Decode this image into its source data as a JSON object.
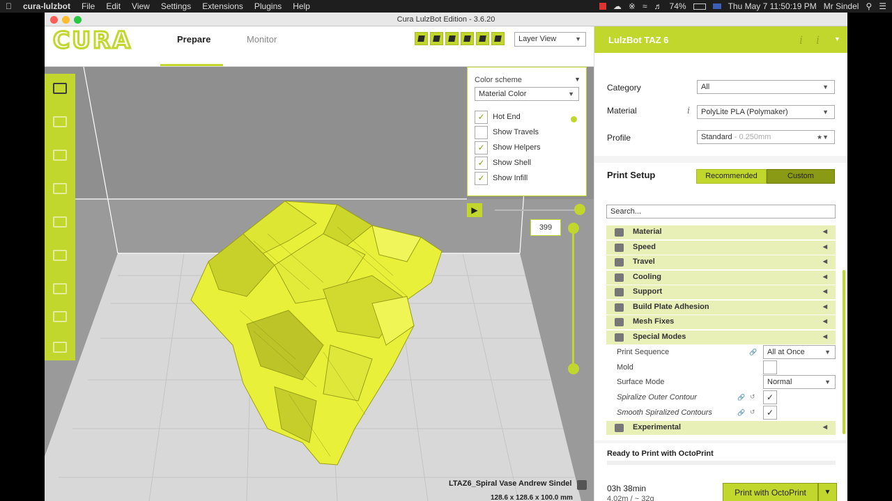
{
  "menubar": {
    "app": "cura-lulzbot",
    "items": [
      "File",
      "Edit",
      "View",
      "Settings",
      "Extensions",
      "Plugins",
      "Help"
    ],
    "battery": "74%",
    "datetime": "Thu May 7  11:50:19 PM",
    "user": "Mr Sindel"
  },
  "window": {
    "title": "Cura LulzBot Edition - 3.6.20"
  },
  "header": {
    "logo": "CURA",
    "tabs": [
      "Prepare",
      "Monitor"
    ],
    "view_mode": "Layer View"
  },
  "color_panel": {
    "label": "Color scheme",
    "scheme": "Material Color",
    "options": [
      {
        "label": "Hot End",
        "checked": true
      },
      {
        "label": "Show Travels",
        "checked": false
      },
      {
        "label": "Show Helpers",
        "checked": true
      },
      {
        "label": "Show Shell",
        "checked": true
      },
      {
        "label": "Show Infill",
        "checked": true
      }
    ]
  },
  "layer_slider": {
    "current_layer": "399"
  },
  "object": {
    "name": "LTAZ6_Spiral Vase Andrew Sindel",
    "dimensions": "128.6 x 128.6 x 100.0 mm"
  },
  "right_panel": {
    "machine": "LulzBot TAZ 6",
    "category_label": "Category",
    "category_value": "All",
    "material_label": "Material",
    "material_value": "PolyLite PLA (Polymaker)",
    "profile_label": "Profile",
    "profile_value": "Standard",
    "profile_dim": "- 0.250mm",
    "print_setup": "Print Setup",
    "recommended": "Recommended",
    "custom": "Custom",
    "search_placeholder": "Search...",
    "categories": [
      "Material",
      "Speed",
      "Travel",
      "Cooling",
      "Support",
      "Build Plate Adhesion",
      "Mesh Fixes",
      "Special Modes",
      "Experimental"
    ],
    "special_settings": {
      "print_sequence_label": "Print Sequence",
      "print_sequence_value": "All at Once",
      "mold_label": "Mold",
      "surface_mode_label": "Surface Mode",
      "surface_mode_value": "Normal",
      "spiralize_label": "Spiralize Outer Contour",
      "smooth_label": "Smooth Spiralized Contours"
    },
    "ready_text": "Ready to Print with OctoPrint",
    "print_time": "03h 38min",
    "print_material": "4.02m / ~ 32g",
    "print_button": "Print with OctoPrint"
  },
  "colors": {
    "accent": "#c1d72e",
    "accent_dark": "#8a9a14",
    "model": "#e8f03a"
  }
}
